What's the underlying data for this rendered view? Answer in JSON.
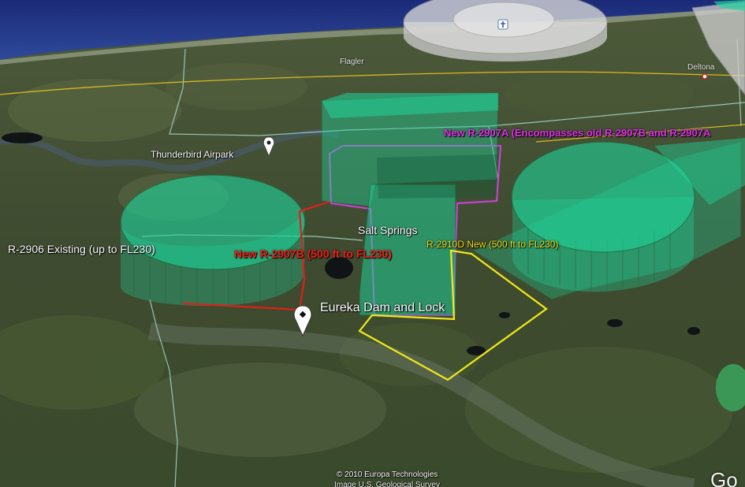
{
  "map": {
    "place_labels": {
      "thunderbird": "Thunderbird Airpark",
      "salt_springs": "Salt Springs",
      "eureka": "Eureka Dam and Lock",
      "flagler": "Flagler",
      "deltona": "Deltona"
    },
    "airspace_labels": {
      "r2906": "R-2906 Existing (up to FL230)",
      "r2907b": "New R-2907B (500 ft to FL230)",
      "r2907a": "New R-2907A (Encompasses old R-2907B and R-2907A",
      "r2910d": "R-2910D New (500 ft to FL230)"
    },
    "attribution": {
      "line1": "© 2010 Europa Technologies",
      "line2": "Image U.S. Geological Survey"
    },
    "logo_text": "Go",
    "colors": {
      "airspace_fill": "#1fd39a",
      "airspace_outline": "#1a6a3a",
      "boundary_magenta": "#d040e0",
      "boundary_yellow": "#f2ea18",
      "boundary_red": "#e0201a",
      "road_yellow": "#d8b820",
      "county_line": "#a8d8cc"
    },
    "icons": [
      "placemark-pin-icon",
      "airport-icon",
      "town-dot-icon"
    ]
  }
}
